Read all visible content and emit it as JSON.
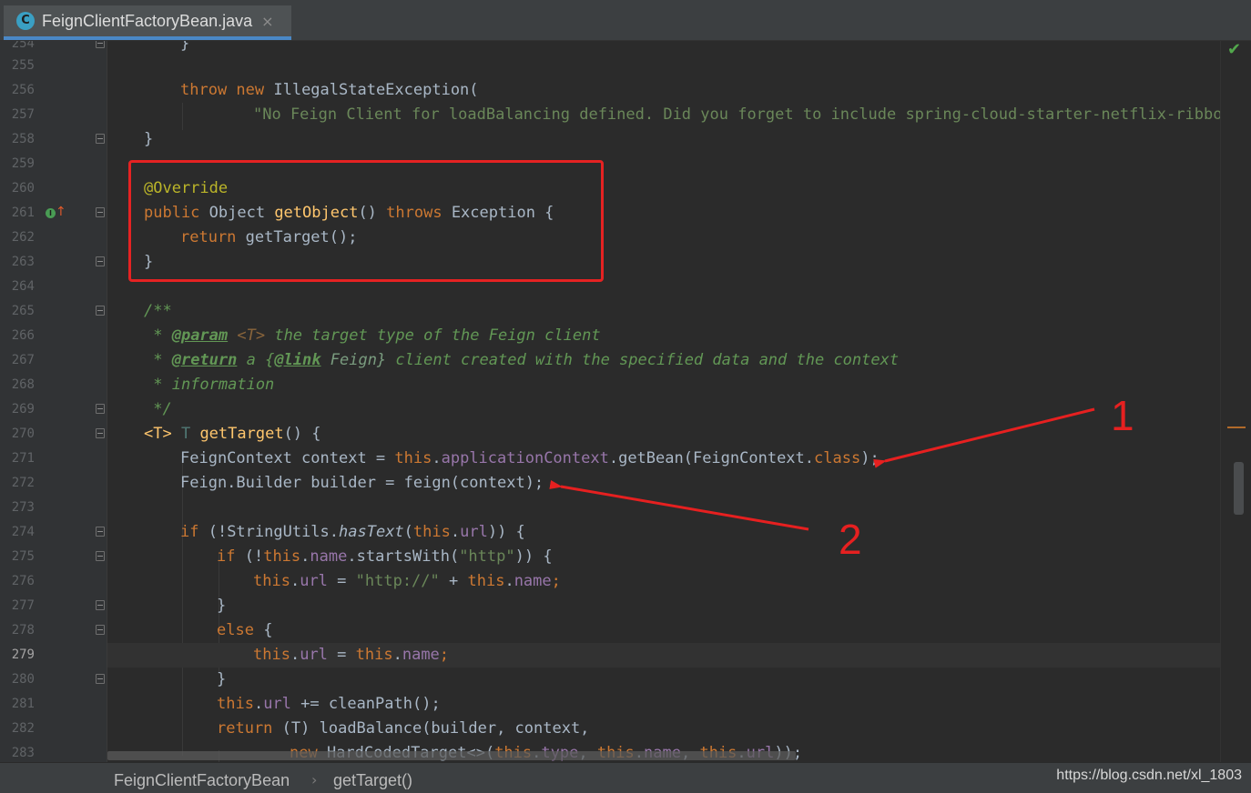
{
  "tab": {
    "title": "FeignClientFactoryBean.java",
    "icon_letter": "C",
    "close_glyph": "×"
  },
  "line_numbers": [
    "254",
    "255",
    "256",
    "257",
    "258",
    "259",
    "260",
    "261",
    "262",
    "263",
    "264",
    "265",
    "266",
    "267",
    "268",
    "269",
    "270",
    "271",
    "272",
    "273",
    "274",
    "275",
    "276",
    "277",
    "278",
    "279",
    "280",
    "281",
    "282",
    "283"
  ],
  "current_line": "279",
  "code": {
    "l254": "}",
    "l256": {
      "a": "throw new ",
      "b": "IllegalStateException("
    },
    "l257": {
      "a": "\"No Feign Client for loadBalancing defined. Did you forget to include spring-cloud-starter-netflix-ribbon?\"",
      "b": ");"
    },
    "l258": "}",
    "l260": "@Override",
    "l261": {
      "a": "public ",
      "b": "Object ",
      "c": "getObject",
      "d": "() ",
      "e": "throws ",
      "f": "Exception {"
    },
    "l262": {
      "a": "return ",
      "b": "getTarget();"
    },
    "l263": "}",
    "l265": "/**",
    "l266": {
      "a": " * ",
      "b": "@param",
      "c": " <T>",
      "d": " the target type of the Feign client"
    },
    "l267": {
      "a": " * ",
      "b": "@return",
      "c": " a {",
      "d": "@link",
      "e": " Feign}",
      "f": " client created with the specified data and the context"
    },
    "l268": " * information",
    "l269": " */",
    "l270": {
      "a": "<T> ",
      "b": "T ",
      "c": "getTarget",
      "d": "() {"
    },
    "l271": {
      "a": "FeignContext context = ",
      "b": "this",
      "c": ".",
      "d": "applicationContext",
      "e": ".getBean(FeignContext.",
      "f": "class",
      "g": ");"
    },
    "l272": "Feign.Builder builder = feign(context);",
    "l274": {
      "a": "if ",
      "b": "(!StringUtils.",
      "c": "hasText",
      "d": "(",
      "e": "this",
      "f": ".",
      "g": "url",
      "h": ")) {"
    },
    "l275": {
      "a": "if ",
      "b": "(!",
      "c": "this",
      "d": ".",
      "e": "name",
      "f": ".startsWith(",
      "g": "\"http\"",
      "h": ")) {"
    },
    "l276": {
      "a": "this",
      "b": ".",
      "c": "url",
      "d": " = ",
      "e": "\"http://\"",
      "f": " + ",
      "g": "this",
      "h": ".",
      "i": "name",
      "j": ";"
    },
    "l277": "}",
    "l278": {
      "a": "else ",
      "b": "{"
    },
    "l279": {
      "a": "this",
      "b": ".",
      "c": "url",
      "d": " = ",
      "e": "this",
      "f": ".",
      "g": "name",
      "h": ";"
    },
    "l280": "}",
    "l281": {
      "a": "this",
      "b": ".",
      "c": "url",
      "d": " += cleanPath();"
    },
    "l282": {
      "a": "return ",
      "b": "(T) ",
      "c": "loadBalance(builder, context,"
    },
    "l283": {
      "a": "new ",
      "b": "HardCodedTarget<>(",
      "c": "this",
      "d": ".",
      "e": "type",
      "f": ", ",
      "g": "this",
      "h": ".",
      "i": "name",
      "j": ", ",
      "k": "this",
      "l": ".",
      "m": "url",
      "n": "));"
    }
  },
  "annotations": {
    "label1": "1",
    "label2": "2",
    "box_color": "#e52222"
  },
  "breadcrumb": {
    "class_name": "FeignClientFactoryBean",
    "method_name": "getTarget()",
    "separator": "›"
  },
  "watermark": "https://blog.csdn.net/xl_1803",
  "inspection_icon": "✔",
  "colors": {
    "keyword": "#cc7832",
    "string": "#6a8759",
    "annotation": "#bbb529",
    "method": "#ffc66d",
    "field": "#9876aa",
    "comment": "#629755",
    "text": "#a9b7c6",
    "background": "#2b2b2b"
  }
}
